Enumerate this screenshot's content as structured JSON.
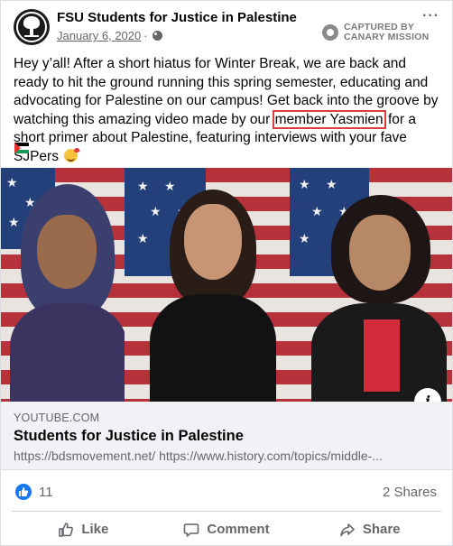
{
  "post": {
    "page_name": "FSU Students for Justice in Palestine",
    "date": "January 6, 2020",
    "separator": "·",
    "menu": "···",
    "text_before": "Hey y’all! After a short hiatus for Winter Break, we are back and ready to hit the ground running this spring semester, educating and advocating for Palestine on our campus! Get back into the groove by watching this amazing video made by our ",
    "text_highlight": "member Yasmien",
    "text_after": " for a short primer about Palestine, featuring interviews with your fave SJPers",
    "emoji_icon": "smiling-face-with-hearts-icon",
    "flag_icon": "palestine-flag-icon"
  },
  "watermark": {
    "line1": "CAPTURED BY",
    "line2": "CANARY MISSION"
  },
  "link_preview": {
    "domain": "YOUTUBE.COM",
    "title": "Students for Justice in Palestine",
    "description": "https://bdsmovement.net/ https://www.history.com/topics/middle-..."
  },
  "reactions": {
    "count": "11",
    "shares": "2 Shares"
  },
  "actions": {
    "like": "Like",
    "comment": "Comment",
    "share": "Share"
  },
  "colors": {
    "accent": "#1877f2",
    "highlight_box": "#e03c3c",
    "muted_text": "#65676b"
  }
}
